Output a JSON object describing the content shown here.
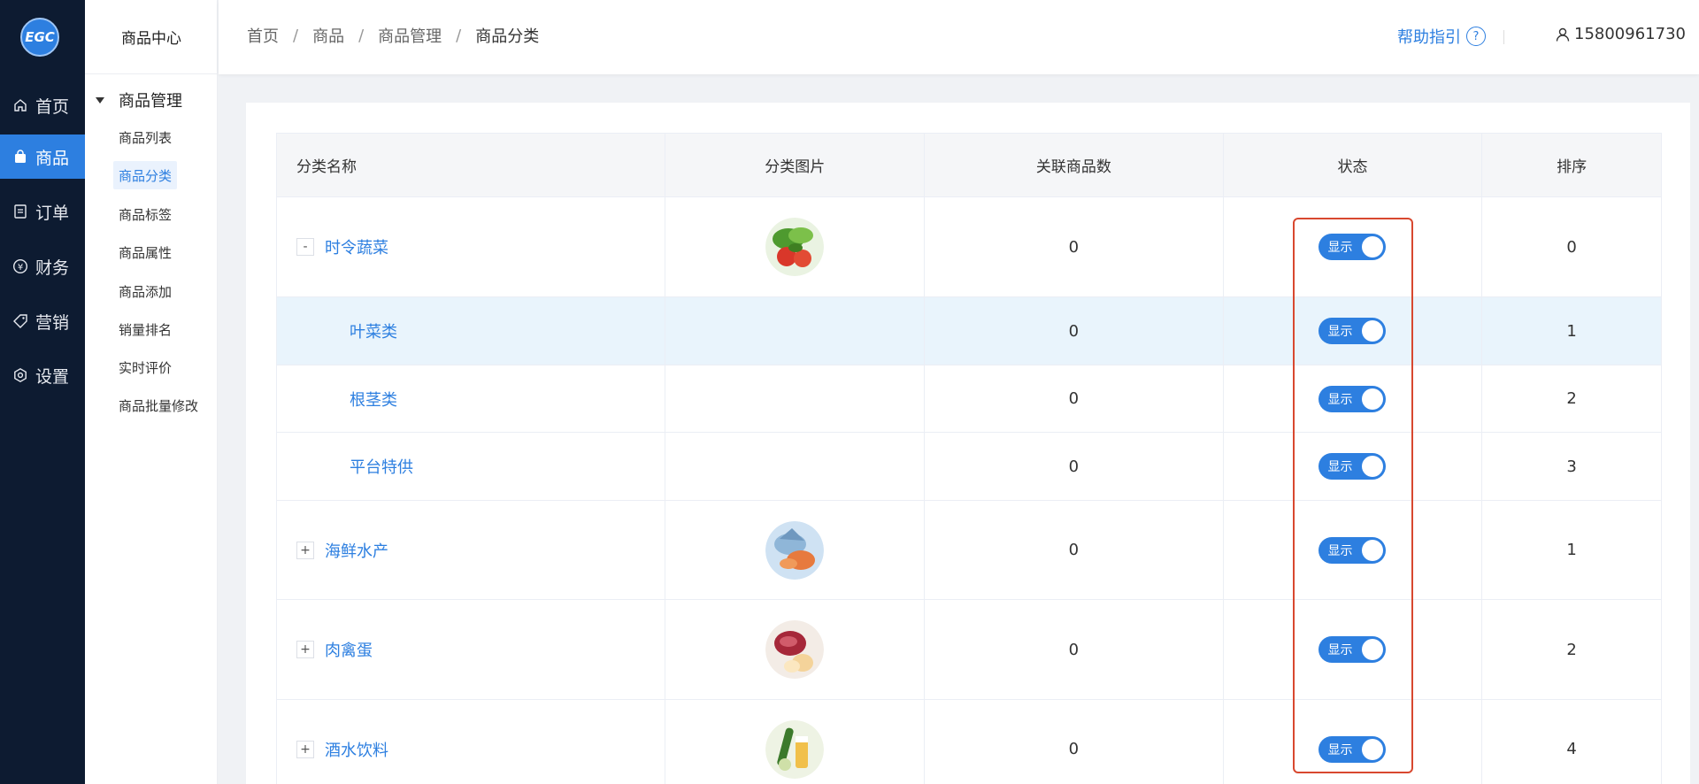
{
  "logo": {
    "text": "EGC"
  },
  "nav": {
    "items": [
      {
        "label": "首页",
        "icon": "home-icon"
      },
      {
        "label": "商品",
        "icon": "bag-icon"
      },
      {
        "label": "订单",
        "icon": "order-icon"
      },
      {
        "label": "财务",
        "icon": "yen-icon"
      },
      {
        "label": "营销",
        "icon": "tag-icon"
      },
      {
        "label": "设置",
        "icon": "gear-icon"
      }
    ]
  },
  "sidebar": {
    "title": "商品中心",
    "group": "商品管理",
    "items": [
      "商品列表",
      "商品分类",
      "商品标签",
      "商品属性",
      "商品添加",
      "销量排名",
      "实时评价",
      "商品批量修改"
    ]
  },
  "header": {
    "crumbs": [
      "首页",
      "商品",
      "商品管理",
      "商品分类"
    ],
    "crumb_sep": "/",
    "help": "帮助指引",
    "help_icon_glyph": "?",
    "user": "15800961730"
  },
  "table": {
    "columns": [
      "分类名称",
      "分类图片",
      "关联商品数",
      "状态",
      "排序"
    ],
    "switch_label": "显示",
    "rows": [
      {
        "name": "时令蔬菜",
        "expander": "-",
        "count": "0",
        "sort": "0",
        "image": "vegetables-thumbnail"
      },
      {
        "name": "叶菜类",
        "count": "0",
        "sort": "1"
      },
      {
        "name": "根茎类",
        "count": "0",
        "sort": "2"
      },
      {
        "name": "平台特供",
        "count": "0",
        "sort": "3"
      },
      {
        "name": "海鲜水产",
        "expander": "+",
        "count": "0",
        "sort": "1",
        "image": "seafood-thumbnail"
      },
      {
        "name": "肉禽蛋",
        "expander": "+",
        "count": "0",
        "sort": "2",
        "image": "meat-eggs-thumbnail"
      },
      {
        "name": "酒水饮料",
        "expander": "+",
        "count": "0",
        "sort": "4",
        "image": "drinks-thumbnail"
      }
    ]
  },
  "colors": {
    "primary": "#2d7fe0",
    "nav_bg": "#0d1b31",
    "highlight_box": "#d8482f"
  }
}
